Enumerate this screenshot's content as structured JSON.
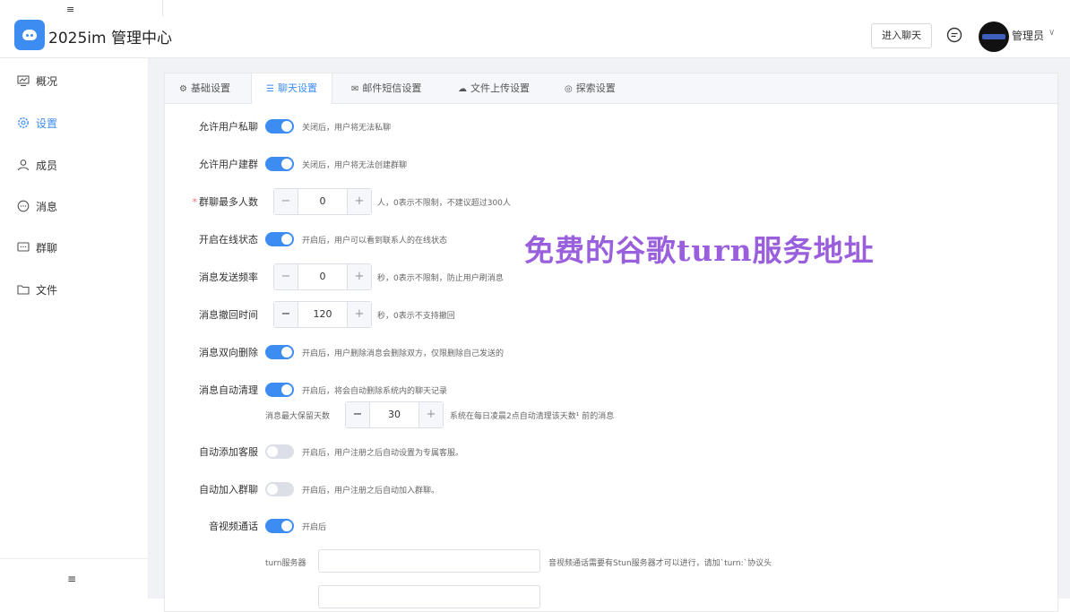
{
  "header": {
    "app_title": "2025im 管理中心",
    "enter_chat_label": "进入聊天",
    "admin_name": "管理员",
    "collapse_glyph": "≡",
    "chevron_glyph": "∨"
  },
  "sidebar": {
    "items": [
      {
        "label": "概况",
        "icon": "monitor-icon",
        "active": false
      },
      {
        "label": "设置",
        "icon": "gear-icon",
        "active": true
      },
      {
        "label": "成员",
        "icon": "user-icon",
        "active": false
      },
      {
        "label": "消息",
        "icon": "message-icon",
        "active": false
      },
      {
        "label": "群聊",
        "icon": "group-chat-icon",
        "active": false
      },
      {
        "label": "文件",
        "icon": "folder-icon",
        "active": false
      }
    ],
    "collapse_glyph": "≡"
  },
  "tabs": [
    {
      "label": "基础设置",
      "icon_glyph": "⚙",
      "icon": "gear-icon",
      "active": false
    },
    {
      "label": "聊天设置",
      "icon_glyph": "☰",
      "icon": "list-icon",
      "active": true
    },
    {
      "label": "邮件短信设置",
      "icon_glyph": "✉",
      "icon": "mail-icon",
      "active": false
    },
    {
      "label": "文件上传设置",
      "icon_glyph": "☁",
      "icon": "cloud-upload-icon",
      "active": false
    },
    {
      "label": "探索设置",
      "icon_glyph": "◎",
      "icon": "compass-icon",
      "active": false
    }
  ],
  "settings": {
    "private_chat": {
      "label": "允许用户私聊",
      "on": true,
      "hint": "关闭后，用户将无法私聊"
    },
    "create_group": {
      "label": "允许用户建群",
      "on": true,
      "hint": "关闭后，用户将无法创建群聊"
    },
    "max_group_members": {
      "label": "群聊最多人数",
      "required_mark": "*",
      "value": "0",
      "hint": "人，0表示不限制，不建议超过300人",
      "minus": "−",
      "plus": "+"
    },
    "online_status": {
      "label": "开启在线状态",
      "on": true,
      "hint": "开启后，用户可以看到联系人的在线状态"
    },
    "send_rate": {
      "label": "消息发送频率",
      "value": "0",
      "hint": "秒，0表示不限制，防止用户刷消息",
      "minus": "−",
      "plus": "+"
    },
    "recall_time": {
      "label": "消息撤回时间",
      "value": "120",
      "hint": "秒，0表示不支持撤回",
      "minus": "−",
      "plus": "+"
    },
    "two_way_delete": {
      "label": "消息双向删除",
      "on": true,
      "hint": "开启后，用户删除消息会删除双方，仅限删除自己发送的"
    },
    "auto_clean": {
      "label": "消息自动清理",
      "on": true,
      "hint": "开启后，将会自动删除系统内的聊天记录",
      "sub_label": "消息最大保留天数",
      "sub_value": "30",
      "sub_hint": "系统在每日凌晨2点自动清理该天数¹  前的消息",
      "minus": "−",
      "plus": "+"
    },
    "auto_service": {
      "label": "自动添加客服",
      "on": false,
      "hint": "开启后，用户注册之后自动设置为专属客服。"
    },
    "auto_join_group": {
      "label": "自动加入群聊",
      "on": false,
      "hint": "开启后，用户注册之后自动加入群聊。"
    },
    "av_call": {
      "label": "音视频通话",
      "on": true,
      "hint": "开启后",
      "turn_label": "turn服务器",
      "turn_hint": "音视频通话需要有Stun服务器才可以进行，请加`turn:`协议头"
    }
  },
  "watermark": "免费的谷歌turn服务地址",
  "colors": {
    "accent": "#3d8cf2",
    "watermark": "#9a5fdc",
    "switch_off": "#dcdfe6"
  }
}
